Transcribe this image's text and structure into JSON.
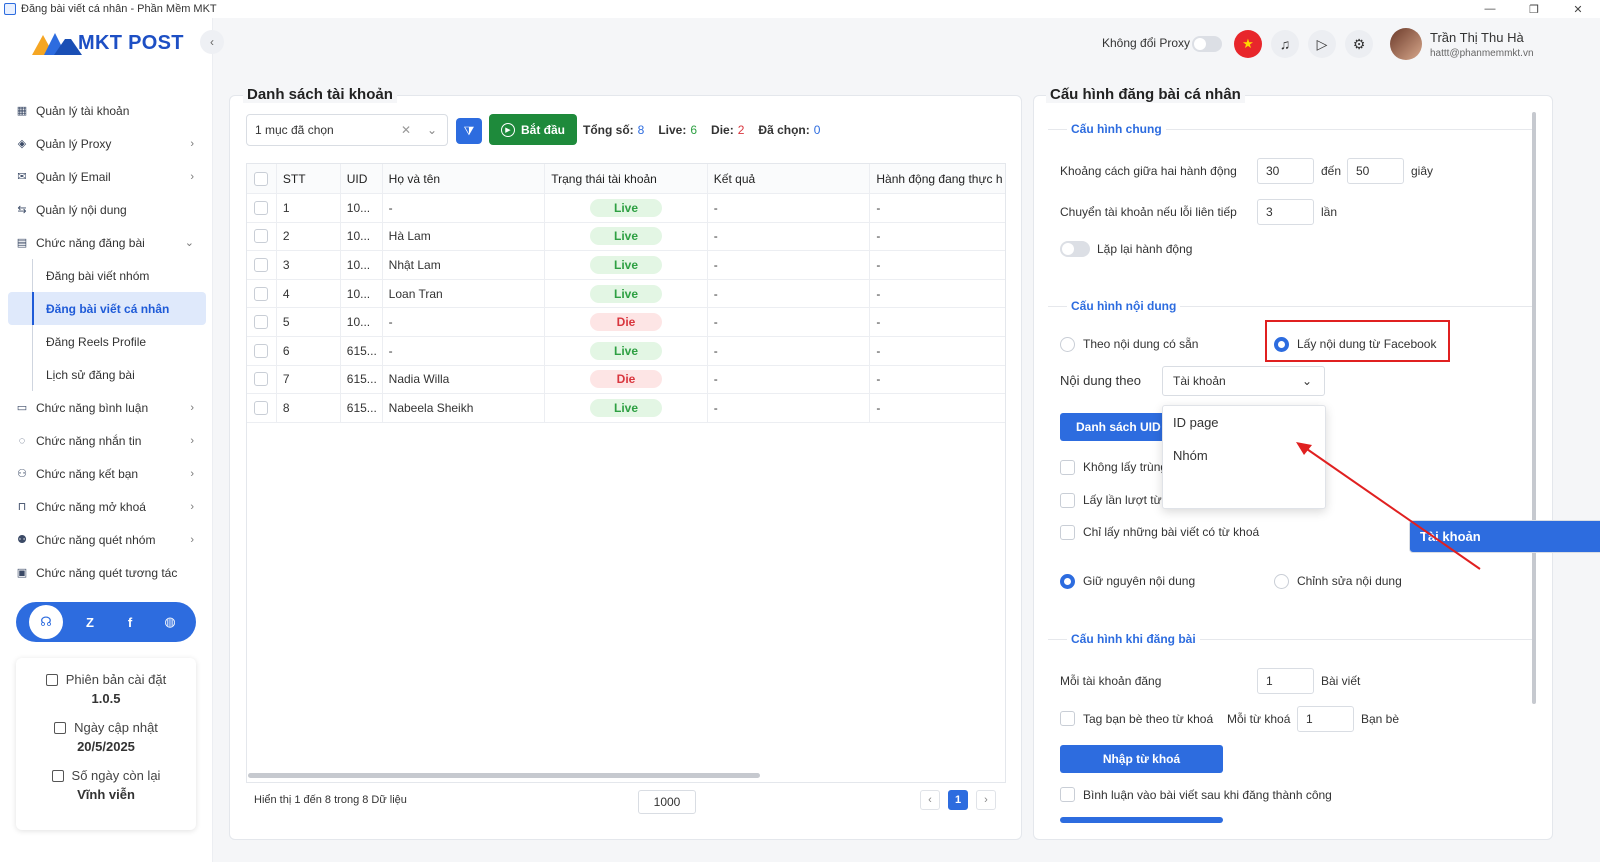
{
  "window": {
    "title": "Đăng bài viết cá nhân - Phần Mềm MKT",
    "controls": [
      "—",
      "❐",
      "✕"
    ]
  },
  "brand": {
    "name": "MKT POST"
  },
  "sidebar": {
    "items": [
      {
        "label": "Quản lý tài khoản",
        "icon": "grid-icon",
        "chevron": ""
      },
      {
        "label": "Quản lý Proxy",
        "icon": "layers-icon",
        "chevron": "›"
      },
      {
        "label": "Quản lý Email",
        "icon": "mail-icon",
        "chevron": "›"
      },
      {
        "label": "Quản lý nội dung",
        "icon": "content-icon",
        "chevron": ""
      },
      {
        "label": "Chức năng đăng bài",
        "icon": "post-icon",
        "chevron": "⌄"
      }
    ],
    "subitems": [
      "Đăng bài viết nhóm",
      "Đăng bài viết cá nhân",
      "Đăng Reels Profile",
      "Lịch sử đăng bài"
    ],
    "items2": [
      {
        "label": "Chức năng bình luận",
        "icon": "comment-icon",
        "chevron": "›"
      },
      {
        "label": "Chức năng nhắn tin",
        "icon": "message-icon",
        "chevron": "›"
      },
      {
        "label": "Chức năng kết bạn",
        "icon": "add-friend-icon",
        "chevron": "›"
      },
      {
        "label": "Chức năng mở khoá",
        "icon": "unlock-icon",
        "chevron": "›"
      },
      {
        "label": "Chức năng quét nhóm",
        "icon": "group-icon",
        "chevron": "›"
      },
      {
        "label": "Chức năng quét tương tác",
        "icon": "scan-icon",
        "chevron": ""
      }
    ],
    "info": {
      "version_label": "Phiên bản cài đặt",
      "version": "1.0.5",
      "update_label": "Ngày cập nhật",
      "update": "20/5/2025",
      "days_label": "Số ngày còn lại",
      "days": "Vĩnh viễn"
    }
  },
  "header": {
    "proxy_label": "Không đổi Proxy",
    "user_name": "Trần Thị Thu Hà",
    "user_email": "hattt@phanmemmkt.vn"
  },
  "accounts": {
    "title": "Danh sách tài khoản",
    "select_value": "1 mục đã chọn",
    "start_label": "Bắt đầu",
    "stats": {
      "total_label": "Tổng số:",
      "total": "8",
      "live_label": "Live:",
      "live": "6",
      "die_label": "Die:",
      "die": "2",
      "selected_label": "Đã chọn:",
      "selected": "0"
    },
    "columns": [
      "STT",
      "UID",
      "Họ và tên",
      "Trạng thái tài khoản",
      "Kết quả",
      "Hành động đang thực h"
    ],
    "rows": [
      {
        "stt": "1",
        "uid": "10...",
        "name": "-",
        "status": "Live",
        "result": "-",
        "action": "-"
      },
      {
        "stt": "2",
        "uid": "10...",
        "name": "Hà Lam",
        "status": "Live",
        "result": "-",
        "action": "-"
      },
      {
        "stt": "3",
        "uid": "10...",
        "name": "Nhật Lam",
        "status": "Live",
        "result": "-",
        "action": "-"
      },
      {
        "stt": "4",
        "uid": "10...",
        "name": "Loan Tran",
        "status": "Live",
        "result": "-",
        "action": "-"
      },
      {
        "stt": "5",
        "uid": "10...",
        "name": "-",
        "status": "Die",
        "result": "-",
        "action": "-"
      },
      {
        "stt": "6",
        "uid": "615...",
        "name": "-",
        "status": "Live",
        "result": "-",
        "action": "-"
      },
      {
        "stt": "7",
        "uid": "615...",
        "name": "Nadia Willa",
        "status": "Die",
        "result": "-",
        "action": "-"
      },
      {
        "stt": "8",
        "uid": "615...",
        "name": "Nabeela Sheikh",
        "status": "Live",
        "result": "-",
        "action": "-"
      }
    ],
    "footer": "Hiển thị 1 đến 8 trong 8 Dữ liệu",
    "page_size": "1000",
    "current_page": "1"
  },
  "config": {
    "title": "Cấu hình đăng bài cá nhân",
    "general": {
      "title": "Cấu hình chung",
      "delay_label": "Khoảng cách giữa hai hành động",
      "delay_from": "30",
      "to_label": "đến",
      "delay_to": "50",
      "sec_label": "giây",
      "switch_label": "Chuyển tài khoản nếu lỗi liên tiếp",
      "switch_value": "3",
      "times_label": "lần",
      "repeat_label": "Lặp lại hành động"
    },
    "content": {
      "title": "Cấu hình nội dung",
      "opt_available": "Theo nội dung có sẵn",
      "opt_facebook": "Lấy nội dung từ Facebook",
      "source_label": "Nội dung theo",
      "source_value": "Tài khoản",
      "uid_button": "Danh sách UID t",
      "no_dup": "Không lấy trùng",
      "in_turn": "Lấy lần lượt từ b",
      "keyword_only": "Chỉ lấy những bài viết có từ khoá",
      "keep": "Giữ nguyên nội dung",
      "edit": "Chỉnh sửa nội dung",
      "options": [
        "Tài khoản",
        "ID page",
        "Nhóm"
      ]
    },
    "posting": {
      "title": "Cấu hình khi đăng bài",
      "per_account_label": "Mỗi tài khoản đăng",
      "per_account": "1",
      "posts_label": "Bài viết",
      "tag_label": "Tag bạn bè theo từ khoá",
      "per_kw_label": "Mỗi từ khoá",
      "per_kw": "1",
      "friends_label": "Bạn bè",
      "import_button": "Nhập từ khoá",
      "comment_label": "Bình luận vào bài viết sau khi đăng thành công"
    }
  },
  "colors": {
    "primary": "#2d6cdf",
    "start": "#1e8a3b",
    "live": "#2ea043",
    "die": "#d9363e",
    "annotation": "#e02020"
  }
}
